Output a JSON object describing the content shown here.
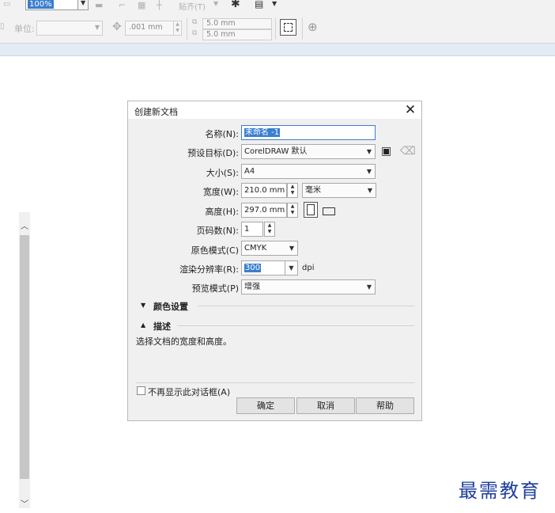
{
  "toolbar_top": {
    "zoom_value": "100%",
    "paste_label": "贴齐(T)",
    "gear_icon": "gear-icon",
    "doc_icon": "page-icon"
  },
  "toolbar_props": {
    "unit_label": "单位:",
    "nudge_value": ".001 mm",
    "dup_x_value": "5.0 mm",
    "dup_y_value": "5.0 mm"
  },
  "dialog": {
    "title": "创建新文档",
    "fields": {
      "name_label": "名称(N):",
      "name_value": "未命名 -1",
      "preset_label": "预设目标(D):",
      "preset_value": "CorelDRAW 默认",
      "size_label": "大小(S):",
      "size_value": "A4",
      "width_label": "宽度(W):",
      "width_value": "210.0 mm",
      "unit_value": "毫米",
      "height_label": "高度(H):",
      "height_value": "297.0 mm",
      "pages_label": "页码数(N):",
      "pages_value": "1",
      "color_mode_label": "原色模式(C)",
      "color_mode_value": "CMYK",
      "resolution_label": "渲染分辨率(R):",
      "resolution_value": "300",
      "resolution_unit": "dpi",
      "preview_label": "预览模式(P)",
      "preview_value": "增强"
    },
    "sections": {
      "color_settings": "颜色设置",
      "description": "描述"
    },
    "description_text": "选择文档的宽度和高度。",
    "dont_show_label": "不再显示此对话框(A)",
    "buttons": {
      "ok": "确定",
      "cancel": "取消",
      "help": "帮助"
    }
  },
  "watermark": "最需教育"
}
